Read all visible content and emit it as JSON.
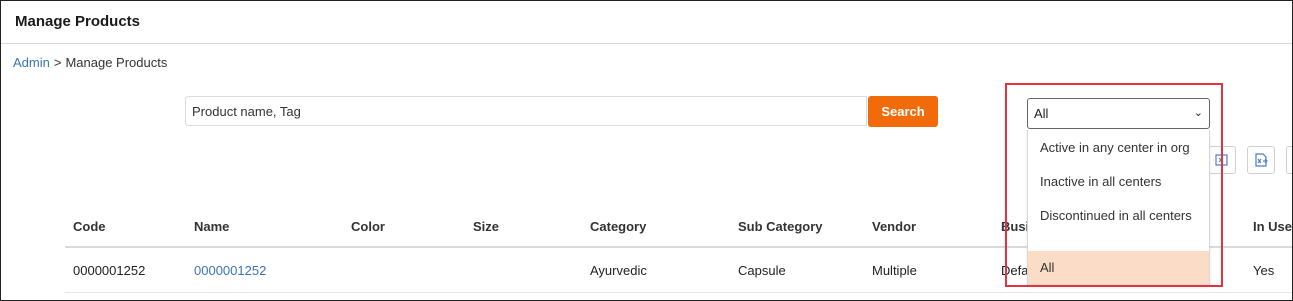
{
  "page": {
    "title": "Manage Products"
  },
  "breadcrumb": {
    "parent": "Admin",
    "separator": ">",
    "current": "Manage Products"
  },
  "search": {
    "placeholder": "Product name, Tag",
    "button_label": "Search",
    "button_color": "#f26b0a"
  },
  "toolbar": {
    "icons": [
      "import-icon",
      "export-excel-icon",
      "more-icon"
    ]
  },
  "filter": {
    "selected": "All",
    "options": [
      "Active in any center in org",
      "Inactive in all centers",
      "Discontinued in all centers",
      "All"
    ],
    "highlight_color": "#e3343c"
  },
  "table": {
    "columns": [
      "Code",
      "Name",
      "Color",
      "Size",
      "Category",
      "Sub Category",
      "Vendor",
      "Busi",
      "In Use"
    ],
    "rows": [
      {
        "code": "0000001252",
        "name": "0000001252",
        "color": "",
        "size": "",
        "category": "Ayurvedic",
        "sub_category": "Capsule",
        "vendor": "Multiple",
        "business": "Defa",
        "in_use": "Yes"
      }
    ]
  }
}
